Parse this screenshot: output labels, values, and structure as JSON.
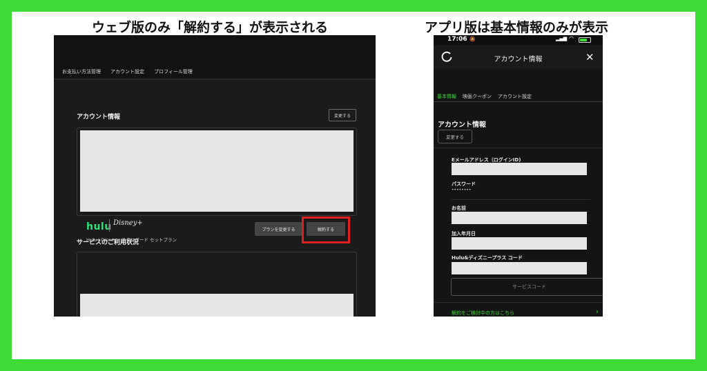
{
  "headings": {
    "web": "ウェブ版のみ「解約する」が表示される",
    "app": "アプリ版は基本情報のみが表示"
  },
  "colors": {
    "frame": "#3ddc36",
    "accent_green": "#3ddc36",
    "highlight_red": "#e02020",
    "hulu_green": "#2fe37a"
  },
  "web": {
    "nav": [
      "お支払い方法管理",
      "アカウント設定",
      "プロフィール管理"
    ],
    "account_section_title": "アカウント情報",
    "change_button": "変更する",
    "services_section_title": "サービスのご利用状況",
    "hulu_logo": "hulu",
    "disney_logo": "Disney+",
    "plan_name": "Hulu | Disney+ スタンダード セットプラン",
    "change_plan_button": "プランを変更する",
    "cancel_button": "解約する"
  },
  "app": {
    "status": {
      "time": "17:06"
    },
    "title": "アカウント情報",
    "tabs": [
      {
        "label": "基本情報",
        "active": true
      },
      {
        "label": "映画クーポン",
        "active": false
      },
      {
        "label": "アカウント設定",
        "active": false
      }
    ],
    "section_title": "アカウント情報",
    "change_button": "変更する",
    "fields": [
      {
        "label": "Eメールアドレス（ログインID)"
      },
      {
        "label": "パスワード",
        "value": "••••••••"
      },
      {
        "label": "お名前"
      },
      {
        "label": "加入年月日"
      },
      {
        "label": "Hulu&ディズニープラス コード"
      }
    ],
    "service_code_button": "サービスコード",
    "cancel_link": "解約をご検討中の方はこちら",
    "icons": [
      "refresh-icon",
      "close-icon",
      "chevron-right-icon"
    ]
  }
}
